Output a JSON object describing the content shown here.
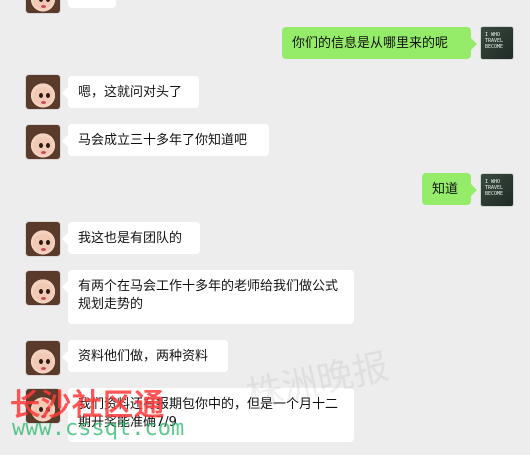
{
  "chat": {
    "messages": [
      {
        "side": "left",
        "text": ""
      },
      {
        "side": "right",
        "text": "你们的信息是从哪里来的呢"
      },
      {
        "side": "left",
        "text": "嗯，这就问对头了"
      },
      {
        "side": "left",
        "text": "马会成立三十多年了你知道吧"
      },
      {
        "side": "right",
        "text": "知道"
      },
      {
        "side": "left",
        "text": "我这也是有团队的"
      },
      {
        "side": "left",
        "text": "有两个在马会工作十多年的老师给我们做公式规划走势的"
      },
      {
        "side": "left",
        "text": "资料他们做，两种资料"
      },
      {
        "side": "left",
        "text": "我们资料还有报期包你中的，但是一个月十二期开奖能准确7/9"
      }
    ]
  },
  "avatar_right": {
    "label": "I WHO TRAVEL BECOME"
  },
  "watermarks": {
    "red": "长沙社区通",
    "green": "www.cssqt.com",
    "gray": "株洲晚报"
  }
}
